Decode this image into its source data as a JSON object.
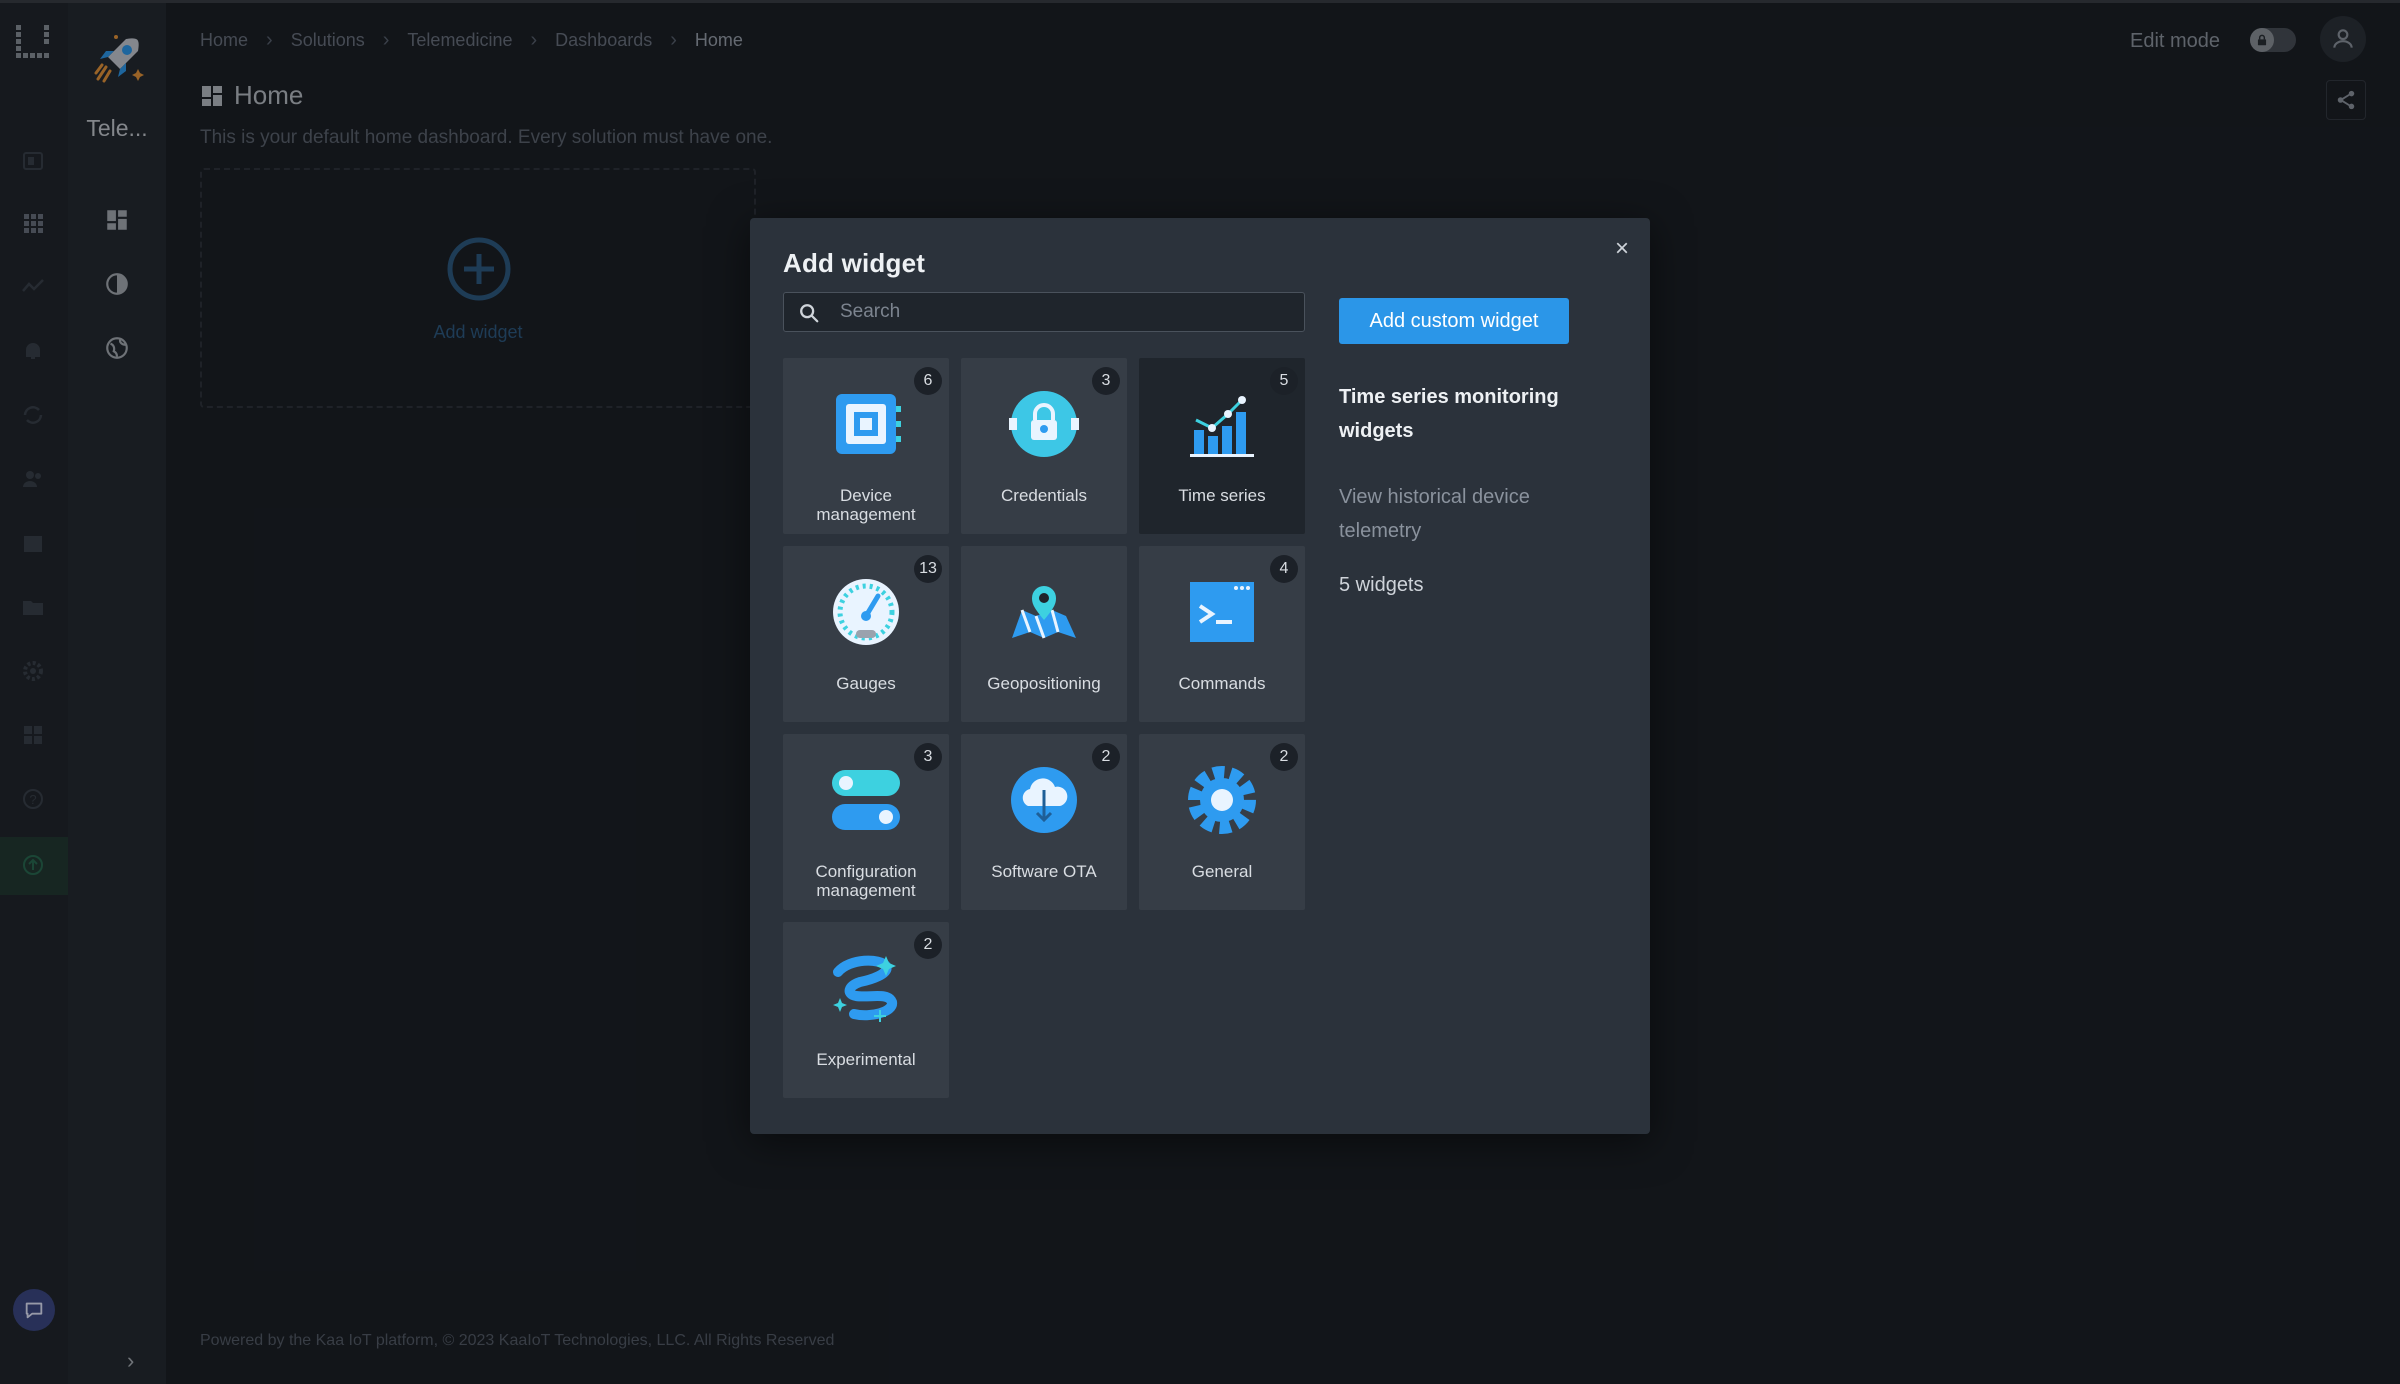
{
  "breadcrumbs": [
    "Home",
    "Solutions",
    "Telemedicine",
    "Dashboards",
    "Home"
  ],
  "header": {
    "edit_mode_label": "Edit mode"
  },
  "sidebar": {
    "solution_short_name": "Tele..."
  },
  "page": {
    "title": "Home",
    "description": "This is your default home dashboard. Every solution must have one.",
    "add_widget_label": "Add widget"
  },
  "footer": {
    "text": "Powered by the Kaa IoT platform, © 2023 KaaIoT Technologies, LLC. All Rights Reserved"
  },
  "modal": {
    "title": "Add widget",
    "search_placeholder": "Search",
    "custom_button_label": "Add custom widget",
    "categories": [
      {
        "name": "Device management",
        "count": "6",
        "icon": "chip-icon"
      },
      {
        "name": "Credentials",
        "count": "3",
        "icon": "lock-icon"
      },
      {
        "name": "Time series",
        "count": "5",
        "icon": "bar-chart-icon",
        "selected": true
      },
      {
        "name": "Gauges",
        "count": "13",
        "icon": "gauge-icon"
      },
      {
        "name": "Geopositioning",
        "count": "",
        "icon": "map-pin-icon"
      },
      {
        "name": "Commands",
        "count": "4",
        "icon": "terminal-icon"
      },
      {
        "name": "Configuration management",
        "count": "3",
        "icon": "toggles-icon"
      },
      {
        "name": "Software OTA",
        "count": "2",
        "icon": "cloud-download-icon"
      },
      {
        "name": "General",
        "count": "2",
        "icon": "gear-icon"
      },
      {
        "name": "Experimental",
        "count": "2",
        "icon": "sparkle-icon"
      }
    ],
    "details": {
      "title": "Time series monitoring widgets",
      "description": "View historical device telemetry",
      "count_label": "5 widgets"
    }
  },
  "colors": {
    "accent": "#2b96e8",
    "icon_blue": "#2e9bf0",
    "icon_cyan": "#3dd1e0",
    "background": "#1c2027",
    "modal": "#2b323b",
    "tile": "#363d46"
  }
}
